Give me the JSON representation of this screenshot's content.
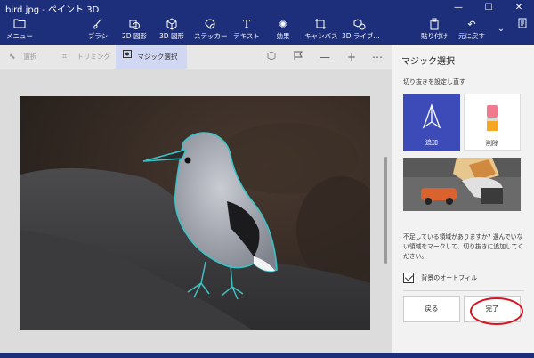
{
  "window": {
    "title": "bird.jpg - ペイント 3D",
    "minimize": "—",
    "maximize": "☐",
    "close": "✕"
  },
  "ribbon": {
    "menu": "メニュー",
    "tools": [
      {
        "name": "brush",
        "label": "ブラシ"
      },
      {
        "name": "2d-shapes",
        "label": "2D 図形"
      },
      {
        "name": "3d-shapes",
        "label": "3D 図形"
      },
      {
        "name": "stickers",
        "label": "ステッカー"
      },
      {
        "name": "text",
        "label": "テキスト"
      },
      {
        "name": "effects",
        "label": "効果"
      },
      {
        "name": "canvas",
        "label": "キャンバス"
      },
      {
        "name": "3d-library",
        "label": "3D ライブ..."
      }
    ],
    "paste": "貼り付け",
    "undo": "元に戻す",
    "more": "⌄"
  },
  "toolbar": {
    "select": "選択",
    "crop": "トリミング",
    "magic_select": "マジック選択",
    "minus": "—",
    "plus": "+",
    "more": "⋯"
  },
  "panel": {
    "title": "マジック選択",
    "hint": "切り抜きを設定し直す",
    "add_label": "追加",
    "remove_label": "削除",
    "description": "不足している領域がありますか? 選んでいない領域をマークして、切り抜きに追加してください。",
    "autofill_label": "背景のオートフィル",
    "autofill_checked": true,
    "back_button": "戻る",
    "done_button": "完了"
  },
  "colors": {
    "ribbon": "#1d2f7a",
    "accent": "#3c4bb8",
    "annotation": "#d8131f"
  }
}
